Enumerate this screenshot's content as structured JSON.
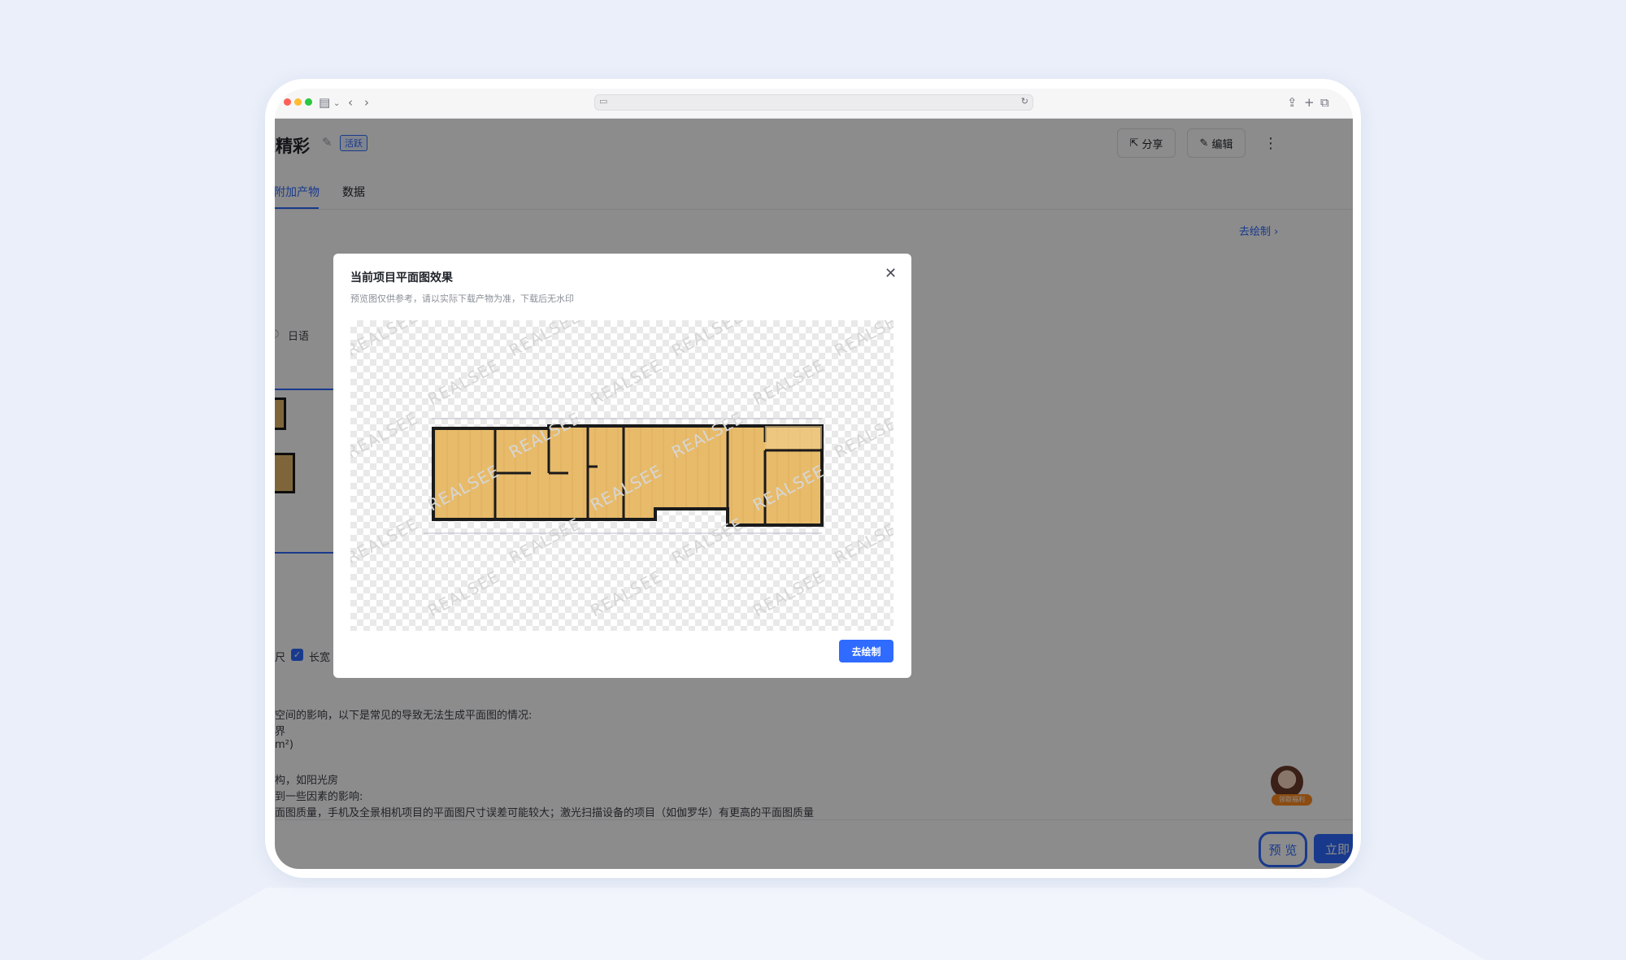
{
  "header": {
    "title": "采精彩",
    "status_badge": "活跃",
    "share_label": "分享",
    "edit_label": "编辑",
    "more_icon": "more-icon"
  },
  "tabs": [
    {
      "label": "附加产物",
      "active": true
    },
    {
      "label": "数据",
      "active": false
    }
  ],
  "draw_link": "去绘制 ›",
  "options": {
    "language_option": "日语",
    "size_option_partial": "尺",
    "length_width_option": "长宽"
  },
  "notes": [
    "空间的影响，以下是常见的导致无法生成平面图的情况:",
    "界",
    "m²)",
    "构，如阳光房",
    "到一些因素的影响:",
    "面图质量，手机及全景相机项目的平面图尺寸误差可能较大；激光扫描设备的项目（如伽罗华）有更高的平面图质量"
  ],
  "footer": {
    "preview_button": "预 览",
    "publish_button": "立即",
    "assistant_tag": "领取福利"
  },
  "modal": {
    "title": "当前项目平面图效果",
    "subtitle": "预览图仅供参考，请以实际下载产物为准，下载后无水印",
    "watermark": "REALSEE",
    "action_button": "去绘制",
    "close_icon": "close-icon"
  },
  "colors": {
    "accent": "#2f6bff",
    "floor": "#e8bb6a",
    "wall": "#1a1a1a"
  }
}
